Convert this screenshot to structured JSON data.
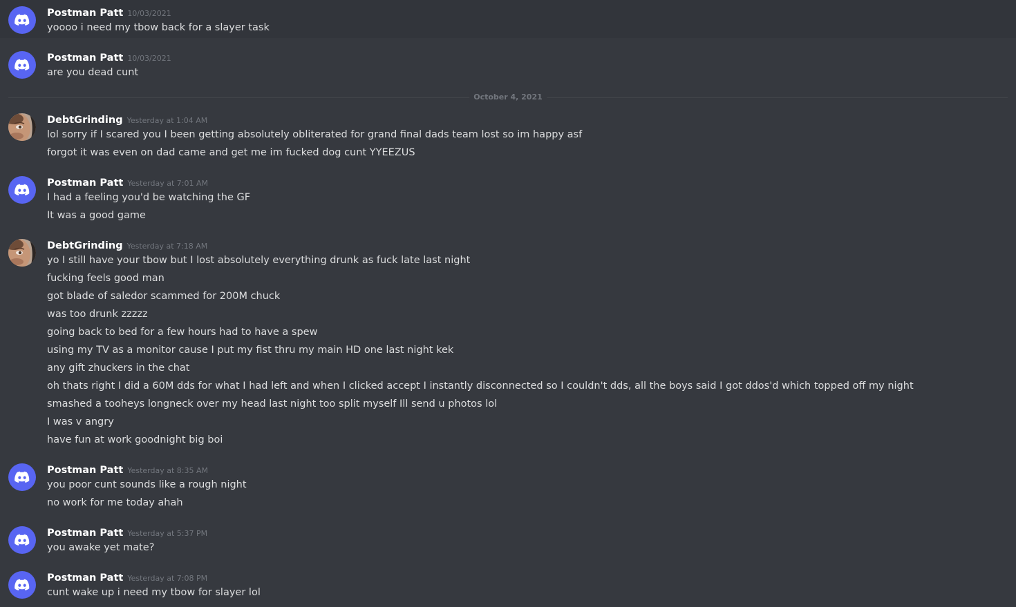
{
  "colors": {
    "background": "#36393f",
    "hover_background": "#32353b",
    "discord_blurple": "#5865f2",
    "username": "#ffffff",
    "message_text": "#dcddde",
    "timestamp": "#72767d"
  },
  "date_divider": "October 4, 2021",
  "groups": [
    {
      "username": "Postman Patt",
      "avatar": "discord-default-avatar",
      "timestamp": "10/03/2021",
      "messages": [
        "yoooo i need my tbow back for a slayer task"
      ]
    },
    {
      "username": "Postman Patt",
      "avatar": "discord-default-avatar",
      "timestamp": "10/03/2021",
      "messages": [
        "are you dead cunt"
      ]
    },
    {
      "username": "DebtGrinding",
      "avatar": "user-photo-avatar",
      "timestamp": "Yesterday at 1:04 AM",
      "messages": [
        "lol sorry if I scared you I been getting absolutely obliterated for grand final dads team lost so im happy asf",
        "forgot it was even on dad came and get me im fucked dog cunt YYEEZUS"
      ]
    },
    {
      "username": "Postman Patt",
      "avatar": "discord-default-avatar",
      "timestamp": "Yesterday at 7:01 AM",
      "messages": [
        "I had a feeling you'd be watching the GF",
        "It was a good game"
      ]
    },
    {
      "username": "DebtGrinding",
      "avatar": "user-photo-avatar",
      "timestamp": "Yesterday at 7:18 AM",
      "messages": [
        "yo I still have your tbow but I lost absolutely everything drunk as fuck late last night",
        "fucking feels good man",
        "got blade of saledor scammed for 200M chuck",
        "was too drunk zzzzz",
        "going back to bed for a few hours had to have a spew",
        "using my TV as a monitor cause I put my fist thru my main HD one last night kek",
        "any gift zhuckers in the chat",
        "oh thats right I did a 60M dds for what I had left and when I clicked accept I instantly disconnected so I couldn't dds, all the boys said I got ddos'd which topped off my night",
        "smashed a tooheys longneck over my head last night too split myself Ill send u photos lol",
        "I was v angry",
        "have fun at work goodnight big boi"
      ]
    },
    {
      "username": "Postman Patt",
      "avatar": "discord-default-avatar",
      "timestamp": "Yesterday at 8:35 AM",
      "messages": [
        "you poor cunt sounds like a rough night",
        "no work for me today ahah"
      ]
    },
    {
      "username": "Postman Patt",
      "avatar": "discord-default-avatar",
      "timestamp": "Yesterday at 5:37 PM",
      "messages": [
        "you awake yet mate?"
      ]
    },
    {
      "username": "Postman Patt",
      "avatar": "discord-default-avatar",
      "timestamp": "Yesterday at 7:08 PM",
      "messages": [
        "cunt wake up i need my tbow for slayer lol"
      ]
    }
  ]
}
